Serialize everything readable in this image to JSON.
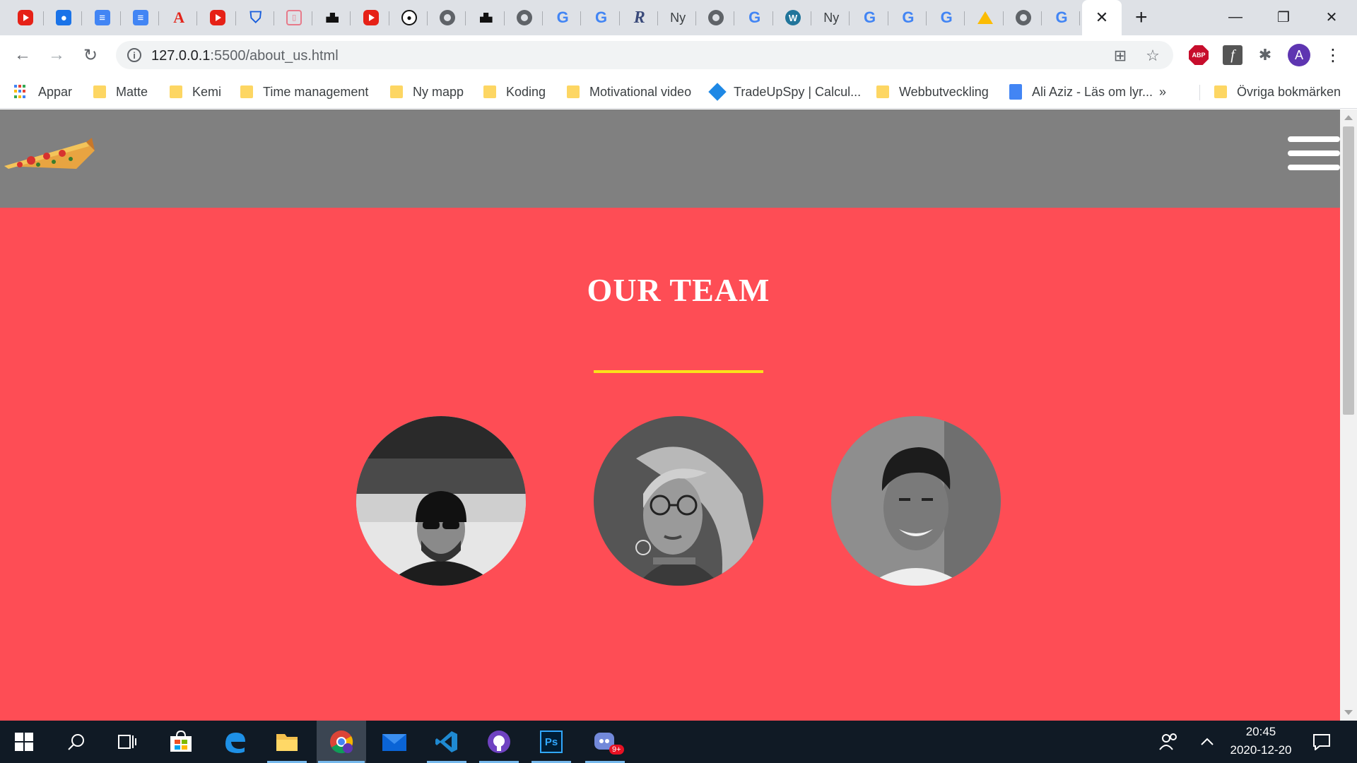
{
  "browser": {
    "tabs": [
      {
        "icon": "youtube-icon",
        "glyph": ""
      },
      {
        "icon": "contacts-icon",
        "glyph": "●"
      },
      {
        "icon": "google-docs-icon",
        "glyph": "≡"
      },
      {
        "icon": "google-docs-icon",
        "glyph": "≡"
      },
      {
        "icon": "adobe-acrobat-icon",
        "glyph": "A"
      },
      {
        "icon": "youtube-icon",
        "glyph": ""
      },
      {
        "icon": "shield-icon",
        "glyph": "⛉"
      },
      {
        "icon": "microsoft-icon",
        "glyph": "▯"
      },
      {
        "icon": "unsplash-icon",
        "glyph": ""
      },
      {
        "icon": "youtube-icon",
        "glyph": ""
      },
      {
        "icon": "panda-icon",
        "glyph": "●"
      },
      {
        "icon": "globe-icon",
        "glyph": ""
      },
      {
        "icon": "unsplash-icon",
        "glyph": ""
      },
      {
        "icon": "globe-icon",
        "glyph": ""
      },
      {
        "icon": "google-icon",
        "glyph": "G"
      },
      {
        "icon": "google-icon",
        "glyph": "G"
      },
      {
        "icon": "r-icon",
        "glyph": "R"
      },
      {
        "icon": "ny-icon",
        "glyph": "Ny"
      },
      {
        "icon": "globe-icon",
        "glyph": ""
      },
      {
        "icon": "google-icon",
        "glyph": "G"
      },
      {
        "icon": "wordpress-icon",
        "glyph": "W"
      },
      {
        "icon": "ny-icon",
        "glyph": "Ny"
      },
      {
        "icon": "google-icon",
        "glyph": "G"
      },
      {
        "icon": "google-icon",
        "glyph": "G"
      },
      {
        "icon": "google-icon",
        "glyph": "G"
      },
      {
        "icon": "google-drive-icon",
        "glyph": ""
      },
      {
        "icon": "globe-icon",
        "glyph": ""
      },
      {
        "icon": "google-icon",
        "glyph": "G"
      }
    ],
    "active_tab_close": "✕",
    "new_tab": "+",
    "window_controls": {
      "minimize": "—",
      "restore": "❐",
      "close": "✕"
    },
    "nav": {
      "back": "←",
      "forward": "→",
      "reload": "↻"
    },
    "address": {
      "host": "127.0.0.1",
      "path": ":5500/about_us.html"
    },
    "toolbar_icons": {
      "translate": "⊞",
      "bookmark_star": "☆",
      "abp_label": "ABP",
      "fx_label": "f",
      "extensions": "✱",
      "avatar_letter": "A",
      "menu": "⋮"
    },
    "bookmarks": [
      {
        "label": "Appar",
        "icon": "apps-grid-icon"
      },
      {
        "label": "Matte",
        "icon": "folder-icon"
      },
      {
        "label": "Kemi",
        "icon": "folder-icon"
      },
      {
        "label": "Time management",
        "icon": "folder-icon"
      },
      {
        "label": "Ny mapp",
        "icon": "folder-icon"
      },
      {
        "label": "Koding",
        "icon": "folder-icon"
      },
      {
        "label": "Motivational video",
        "icon": "folder-icon"
      },
      {
        "label": "TradeUpSpy | Calcul...",
        "icon": "tradeupspy-icon"
      },
      {
        "label": "Webbutveckling",
        "icon": "folder-icon"
      },
      {
        "label": "Ali Aziz - Läs om lyr...",
        "icon": "google-docs-icon"
      }
    ],
    "bookmarks_overflow": "»",
    "other_bookmarks": "Övriga bokmärken"
  },
  "page": {
    "header_bg": "#808080",
    "team_bg": "#fe4d55",
    "accent_rule": "#fbe11a",
    "team_title": "OUR TEAM",
    "members": [
      {
        "photo": "member-photo-beanie-man"
      },
      {
        "photo": "member-photo-woman-glasses"
      },
      {
        "photo": "member-photo-smiling-man"
      }
    ]
  },
  "taskbar": {
    "apps": [
      {
        "icon": "windows-start-icon"
      },
      {
        "icon": "search-icon"
      },
      {
        "icon": "task-view-icon"
      },
      {
        "icon": "store-icon"
      },
      {
        "icon": "edge-icon"
      },
      {
        "icon": "file-explorer-icon"
      },
      {
        "icon": "chrome-icon"
      },
      {
        "icon": "mail-icon"
      },
      {
        "icon": "vscode-icon"
      },
      {
        "icon": "github-desktop-icon"
      },
      {
        "icon": "photoshop-icon"
      },
      {
        "icon": "discord-icon"
      }
    ],
    "ps_label": "Ps",
    "discord_badge": "9+",
    "time": "20:45",
    "date": "2020-12-20"
  }
}
